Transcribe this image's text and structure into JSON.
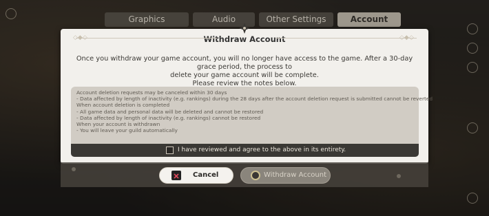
{
  "tabs": [
    {
      "label": "Graphics",
      "active": false
    },
    {
      "label": "Audio",
      "active": false
    },
    {
      "label": "Other Settings",
      "active": false
    },
    {
      "label": "Account",
      "active": true
    }
  ],
  "dialog": {
    "title": "Withdraw Account",
    "description": [
      "Once you withdraw your game account, you will no longer have access to the game. After a 30-day grace period, the process to",
      "delete your game account will be complete.",
      "Please review the notes below."
    ],
    "notes": [
      "Account deletion requests may be canceled within 30 days",
      "- Data affected by length of inactivity (e.g. rankings) during the 28 days after the account deletion request is submitted cannot be reverted",
      "When account deletion is completed",
      "- All game data and personal data will be deleted and cannot be restored",
      "- Data affected by length of inactivity (e.g. rankings) cannot be restored",
      "When your account is withdrawn",
      "- You will leave your guild automatically"
    ],
    "agree_label": "I have reviewed and agree to the above in its entirety.",
    "agree_checked": false
  },
  "buttons": {
    "cancel": {
      "label": "Cancel",
      "icon": "cross-button-icon"
    },
    "withdraw": {
      "label": "Withdraw Account",
      "icon": "circle-button-icon",
      "enabled": false
    }
  },
  "colors": {
    "dialog_bg": "#f2f0ec",
    "notes_bg": "#d1ccc4",
    "agree_bar_bg": "#3a3834",
    "active_tab_bg": "#9d978c"
  }
}
